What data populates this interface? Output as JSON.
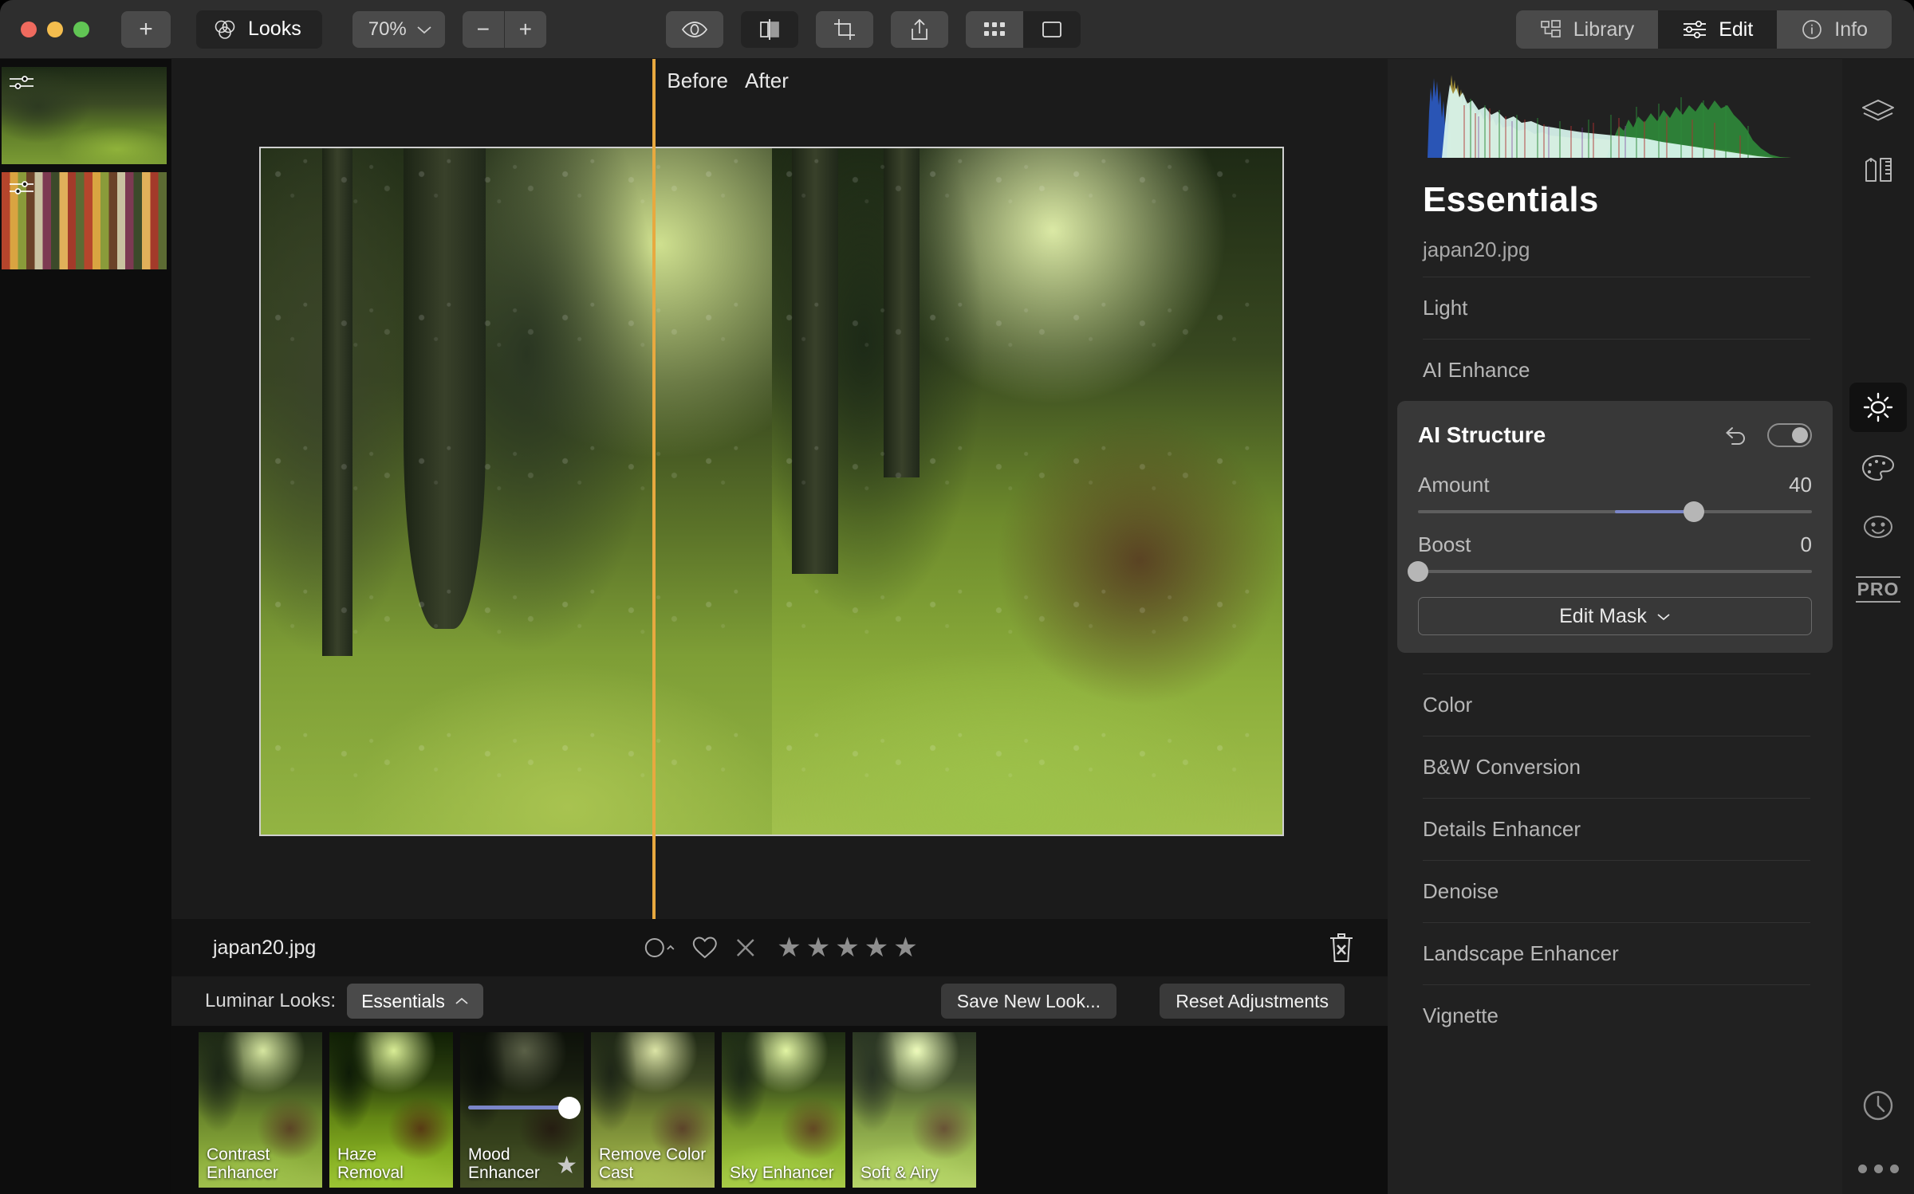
{
  "toolbar": {
    "add_label": "+",
    "looks_label": "Looks",
    "looks_icon": "venn-circles-icon",
    "zoom_value": "70%",
    "zoom_out_label": "−",
    "zoom_in_label": "+",
    "icons": [
      "eye-icon",
      "compare-split-icon",
      "crop-icon",
      "share-icon",
      "grid-view-icon",
      "single-view-icon"
    ],
    "tabs": [
      {
        "label": "Library",
        "icon": "library-icon",
        "selected": false
      },
      {
        "label": "Edit",
        "icon": "sliders-icon",
        "selected": true
      },
      {
        "label": "Info",
        "icon": "info-circle-icon",
        "selected": false
      }
    ]
  },
  "filmstrip": {
    "items": [
      {
        "name": "japan20-thumbnail",
        "art": "art-forest",
        "selected": true,
        "edited": true
      },
      {
        "name": "spices-thumbnail",
        "art": "art-spices",
        "selected": false,
        "edited": true
      }
    ]
  },
  "canvas": {
    "before_label": "Before",
    "after_label": "After",
    "divider_color": "#e8a93f"
  },
  "infobar": {
    "filename": "japan20.jpg",
    "flag_icon": "reject-circle-icon",
    "favorite_icon": "heart-icon",
    "clear_rating_label": "✕",
    "stars": [
      "★",
      "★",
      "★",
      "★",
      "★"
    ],
    "rating": 0,
    "trash_icon": "trash-x-icon"
  },
  "looksbar": {
    "label": "Luminar Looks:",
    "category": "Essentials",
    "category_chevron": "chevron-up-icon",
    "save_label": "Save New Look...",
    "reset_label": "Reset Adjustments"
  },
  "looks": [
    {
      "name": "Contrast Enhancer",
      "art": "lart-base",
      "selected": false,
      "favorite": false
    },
    {
      "name": "Haze Removal",
      "art": "lart-haze",
      "selected": false,
      "favorite": false
    },
    {
      "name": "Mood Enhancer",
      "art": "lart-mood",
      "selected": true,
      "favorite": true,
      "slider_value": 100
    },
    {
      "name": "Remove Color Cast",
      "art": "lart-remove",
      "selected": false,
      "favorite": false
    },
    {
      "name": "Sky Enhancer",
      "art": "lart-sky",
      "selected": false,
      "favorite": false
    },
    {
      "name": "Soft & Airy",
      "art": "lart-airy",
      "selected": false,
      "favorite": false
    }
  ],
  "panel": {
    "title": "Essentials",
    "filename": "japan20.jpg",
    "sections_above": [
      "Light",
      "AI Enhance"
    ],
    "module": {
      "title": "AI Structure",
      "undo_icon": "undo-arrow-icon",
      "toggle_on": true,
      "sliders": [
        {
          "label": "Amount",
          "value": "40",
          "percent": 70,
          "fill_from": 50
        },
        {
          "label": "Boost",
          "value": "0",
          "percent": 0,
          "fill_from": 0
        }
      ],
      "mask_label": "Edit Mask",
      "mask_chevron": "chevron-down-icon"
    },
    "sections_below": [
      "Color",
      "B&W Conversion",
      "Details Enhancer",
      "Denoise",
      "Landscape Enhancer",
      "Vignette"
    ]
  },
  "rail": {
    "icons": [
      {
        "name": "layers-icon",
        "selected": false
      },
      {
        "name": "tools-pencil-ruler-icon",
        "selected": false
      },
      {
        "name": "sun-essentials-icon",
        "selected": true
      },
      {
        "name": "palette-color-icon",
        "selected": false
      },
      {
        "name": "portrait-smiley-icon",
        "selected": false
      },
      {
        "name": "pro-icon",
        "label": "PRO",
        "selected": false
      }
    ],
    "bottom": [
      {
        "name": "history-clock-icon"
      },
      {
        "name": "more-dots-icon"
      }
    ]
  },
  "histogram": {
    "title": "RGB histogram",
    "colors": {
      "luma": "#d8f5ee",
      "red": "#b03030",
      "green": "#2f8a3a",
      "blue": "#2a55b5",
      "yellow": "#b8a23e"
    }
  }
}
